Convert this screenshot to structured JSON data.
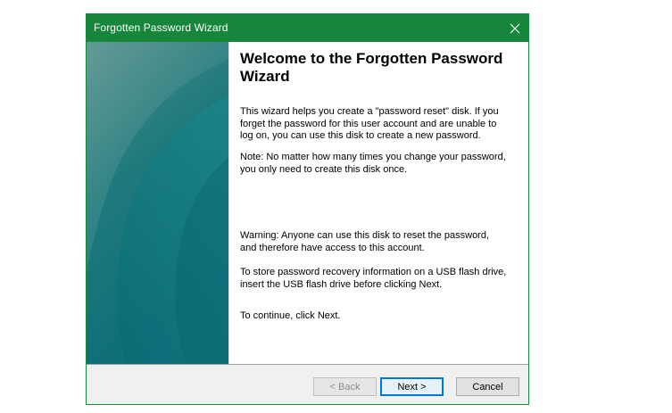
{
  "window": {
    "title": "Forgotten Password Wizard",
    "accent_color": "#16873a"
  },
  "titlebar": {
    "close_icon": "close-icon"
  },
  "content": {
    "heading": "Welcome to the Forgotten Password Wizard",
    "paragraphs": [
      "This wizard helps you create a \"password reset\" disk. If you forget the password for this user account and are unable to log on, you can use this disk to create a new password.",
      "Note: No matter how many times you change your password, you only need to create this disk once.",
      "Warning: Anyone can use this disk to reset the password, and therefore have access to this account.",
      "To store password recovery information on a USB flash drive, insert the USB flash drive before clicking Next.",
      "To continue, click Next."
    ]
  },
  "buttons": {
    "back": "< Back",
    "next": "Next >",
    "cancel": "Cancel"
  }
}
